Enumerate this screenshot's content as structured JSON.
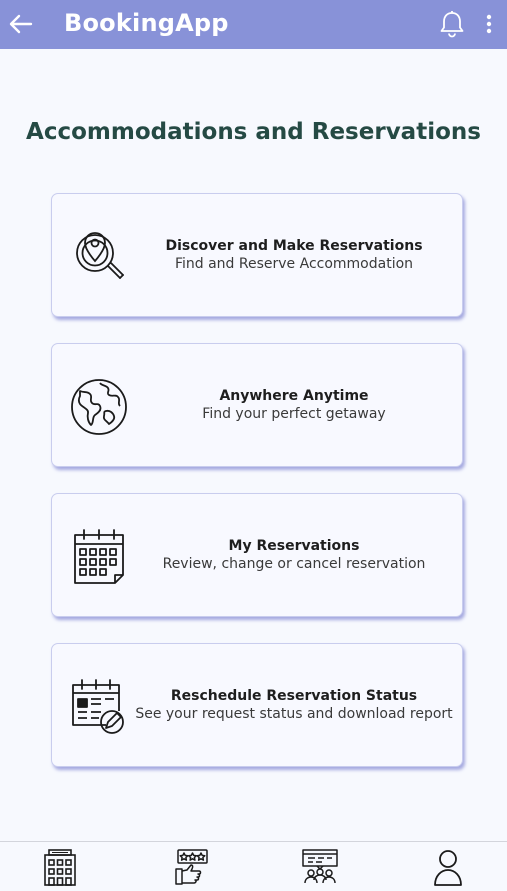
{
  "app": {
    "title": "BookingApp"
  },
  "header": {
    "back_icon": "arrow-left-icon",
    "notification_icon": "bell-icon",
    "menu_icon": "more-vertical-icon"
  },
  "page": {
    "heading": "Accommodations and Reservations"
  },
  "cards": [
    {
      "icon": "location-search-icon",
      "title": "Discover and Make Reservations",
      "subtitle": "Find and Reserve Accommodation"
    },
    {
      "icon": "globe-icon",
      "title": "Anywhere Anytime",
      "subtitle": "Find your perfect getaway"
    },
    {
      "icon": "calendar-icon",
      "title": "My Reservations",
      "subtitle": "Review, change or cancel reservation"
    },
    {
      "icon": "calendar-edit-icon",
      "title": "Reschedule Reservation Status",
      "subtitle": "See your request status and download report"
    }
  ],
  "bottom_nav": [
    {
      "icon": "hotel-icon"
    },
    {
      "icon": "rating-hand-icon"
    },
    {
      "icon": "audience-presentation-icon"
    },
    {
      "icon": "user-icon"
    }
  ],
  "colors": {
    "appbar": "#8892d8",
    "heading": "#254a44",
    "card_shadow": "#646ac8"
  }
}
